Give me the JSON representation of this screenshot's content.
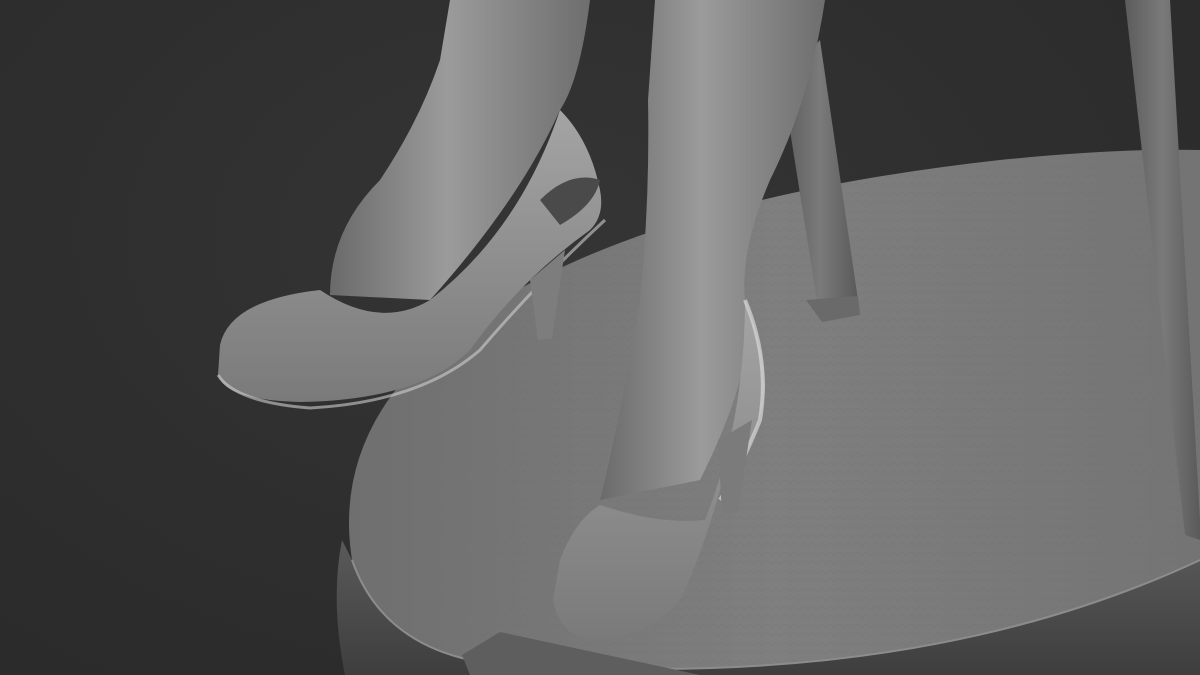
{
  "scene": {
    "subject": "3d-sculpt-render",
    "colors": {
      "background": "#2f2f2f",
      "material": "#8f8f8f",
      "base": "#7a7a7a"
    }
  }
}
